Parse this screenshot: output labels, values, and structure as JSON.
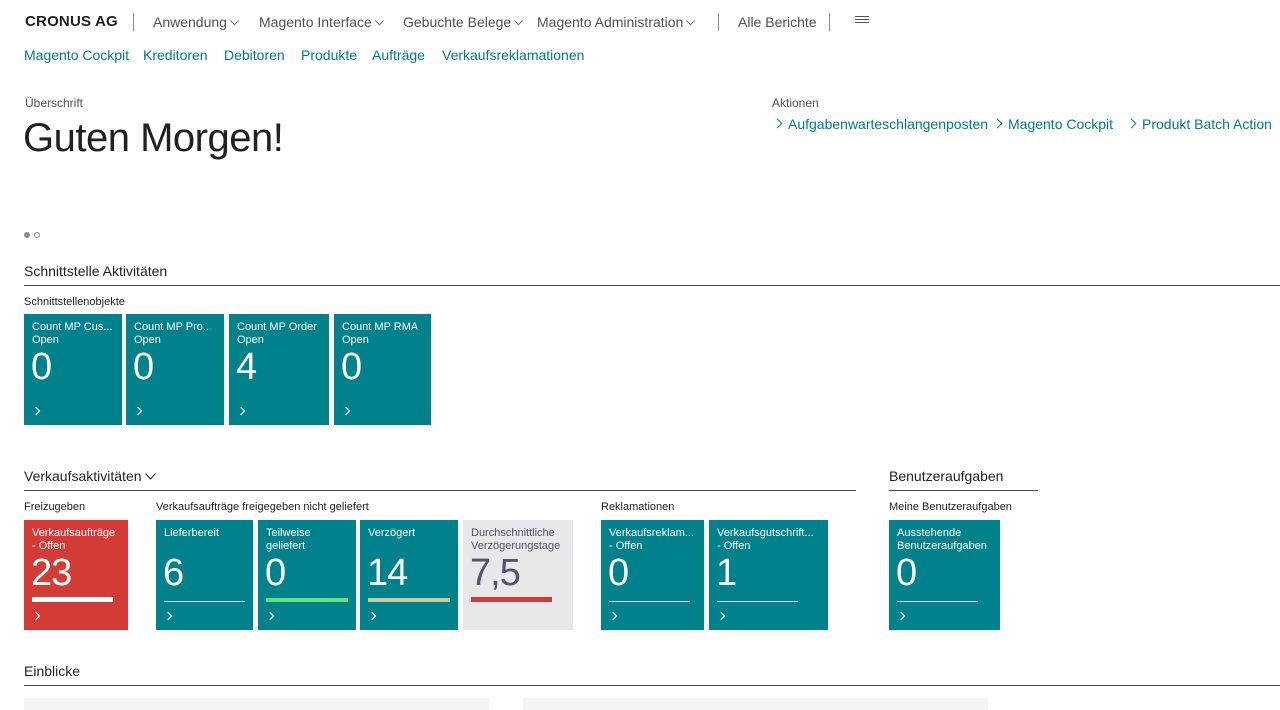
{
  "header": {
    "company": "CRONUS AG",
    "menus": [
      "Anwendung",
      "Magento Interface",
      "Gebuchte Belege",
      "Magento Administration"
    ],
    "all_reports": "Alle Berichte"
  },
  "subnav": [
    "Magento Cockpit",
    "Kreditoren",
    "Debitoren",
    "Produkte",
    "Aufträge",
    "Verkaufsreklamationen"
  ],
  "headline": {
    "caption": "Überschrift",
    "greeting": "Guten Morgen!"
  },
  "actions": {
    "caption": "Aktionen",
    "links": [
      "Aufgabenwarteschlangenposten",
      "Magento Cockpit",
      "Produkt Batch Action"
    ]
  },
  "interface_section": {
    "title": "Schnittstelle Aktivitäten",
    "group": "Schnittstellenobjekte",
    "tiles": [
      {
        "label1": "Count MP Cus...",
        "label2": "Open",
        "value": "0"
      },
      {
        "label1": "Count MP Pro...",
        "label2": "Open",
        "value": "0"
      },
      {
        "label1": "Count MP Order",
        "label2": "Open",
        "value": "4"
      },
      {
        "label1": "Count MP RMA",
        "label2": "Open",
        "value": "0"
      }
    ]
  },
  "sales_section": {
    "title": "Verkaufsaktivitäten",
    "groups": {
      "release": "Freizugeben",
      "released": "Verkaufsaufträge freigegeben nicht geliefert",
      "complaints": "Reklamationen"
    },
    "tiles": {
      "release_open": {
        "label1": "Verkaufsaufträge",
        "label2": "- Offen",
        "value": "23"
      },
      "ready": {
        "label1": "Lieferbereit",
        "label2": "",
        "value": "6"
      },
      "partial": {
        "label1": "Teilweise",
        "label2": "geliefert",
        "value": "0"
      },
      "delayed": {
        "label1": "Verzögert",
        "label2": "",
        "value": "14"
      },
      "avg_delay": {
        "label1": "Durchschnittliche",
        "label2": "Verzögerungstage",
        "value": "7,5"
      },
      "complaints_open": {
        "label1": "Verkaufsreklam...",
        "label2": "- Offen",
        "value": "0"
      },
      "credit_open": {
        "label1": "Verkaufsgutschrift...",
        "label2": "- Offen",
        "value": "1"
      }
    }
  },
  "user_tasks_section": {
    "title": "Benutzeraufgaben",
    "group": "Meine Benutzeraufgaben",
    "tile": {
      "label1": "Ausstehende",
      "label2": "Benutzeraufgaben",
      "value": "0"
    }
  },
  "insights": {
    "title": "Einblicke"
  },
  "colors": {
    "tile_teal": "#00818b",
    "tile_red": "#d33b36",
    "tile_grey": "#e8e8ea",
    "link": "#00798c",
    "bar_green": "#66e07a",
    "bar_sand": "#cfc89b",
    "bar_red": "#d33b36"
  }
}
